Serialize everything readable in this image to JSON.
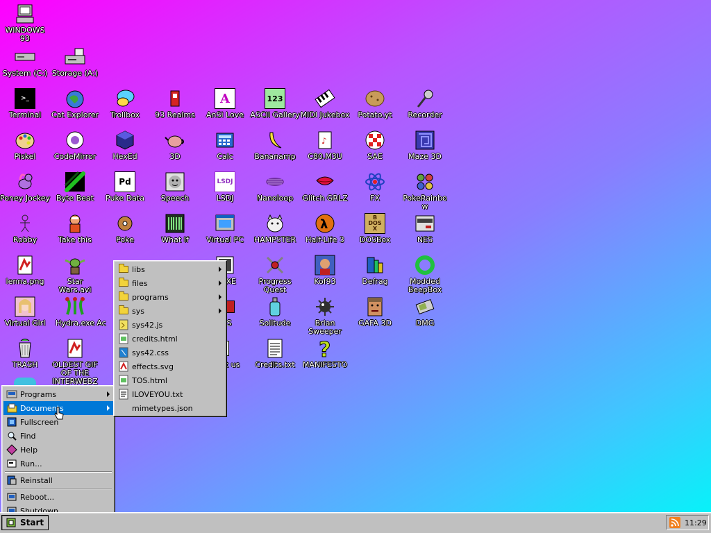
{
  "desktop": {
    "icons": [
      {
        "label": "WINDOWS 93",
        "icon": "computer-icon"
      },
      {
        "label": "System (C:)",
        "icon": "drive-icon"
      },
      {
        "label": "Storage (A:)",
        "icon": "floppy-drive-icon"
      },
      {
        "label": "Terminal",
        "icon": "terminal-icon"
      },
      {
        "label": "Cat Explorer",
        "icon": "cat-globe-icon"
      },
      {
        "label": "Trollbox",
        "icon": "chat-bubble-icon"
      },
      {
        "label": "93 Realms",
        "icon": "realms-icon"
      },
      {
        "label": "AnSi Love",
        "icon": "ansi-icon"
      },
      {
        "label": "ASCII Gallery",
        "icon": "ascii-icon"
      },
      {
        "label": "MIDI Jukebox",
        "icon": "piano-icon"
      },
      {
        "label": "Potato.yt",
        "icon": "potato-icon"
      },
      {
        "label": "Recorder",
        "icon": "microphone-icon"
      },
      {
        "label": "Piskel",
        "icon": "palette-icon"
      },
      {
        "label": "CodeMirror",
        "icon": "codemirror-icon"
      },
      {
        "label": "HexEd",
        "icon": "cube-icon"
      },
      {
        "label": "3D",
        "icon": "teapot-icon"
      },
      {
        "label": "Calc",
        "icon": "calculator-icon"
      },
      {
        "label": "Bananamp",
        "icon": "banana-icon"
      },
      {
        "label": "C80.M3U",
        "icon": "playlist-icon"
      },
      {
        "label": "SAE",
        "icon": "amiga-ball-icon"
      },
      {
        "label": "Maze 3D",
        "icon": "maze-icon"
      },
      {
        "label": "Poney Jockey",
        "icon": "pony-icon"
      },
      {
        "label": "Byte Beat",
        "icon": "bytebeat-icon"
      },
      {
        "label": "Puke Data",
        "icon": "puredata-icon"
      },
      {
        "label": "Speech",
        "icon": "face-icon"
      },
      {
        "label": "LSDJ",
        "icon": "lsdj-icon"
      },
      {
        "label": "Nanoloop",
        "icon": "wave-icon"
      },
      {
        "label": "Glitch GRLZ",
        "icon": "lips-icon"
      },
      {
        "label": "FX",
        "icon": "atom-icon"
      },
      {
        "label": "PokeRainbow",
        "icon": "pokemon-trainers-icon"
      },
      {
        "label": "Robby",
        "icon": "stick-figure-icon"
      },
      {
        "label": "Take this",
        "icon": "take-this-icon"
      },
      {
        "label": "Poke",
        "icon": "pokeball-icon"
      },
      {
        "label": "What If",
        "icon": "barcode-icon"
      },
      {
        "label": "Virtual PC",
        "icon": "virtual-pc-icon"
      },
      {
        "label": "HAMPSTER",
        "icon": "hamster-icon"
      },
      {
        "label": "Half-Life 3",
        "icon": "half-life-icon"
      },
      {
        "label": "DOSBox",
        "icon": "dosbox-icon"
      },
      {
        "label": "NES",
        "icon": "nes-icon"
      },
      {
        "label": "lenna.png",
        "icon": "image-file-icon"
      },
      {
        "label": "Star Wars.avi",
        "icon": "yoda-icon"
      },
      {
        "label": "2.EXE",
        "icon": "exe-icon"
      },
      {
        "label": "Progress Quest",
        "icon": "swords-icon"
      },
      {
        "label": "Kof93",
        "icon": "fighter-icon"
      },
      {
        "label": "Defrag",
        "icon": "defrag-icon"
      },
      {
        "label": "Modded BeepBox",
        "icon": "ring-icon"
      },
      {
        "label": "Virtual Girl",
        "icon": "virtual-girl-icon"
      },
      {
        "label": "Hydra.exe",
        "icon": "hydra-icon"
      },
      {
        "label": "Ac",
        "icon": "app-icon"
      },
      {
        "label": "S",
        "icon": "app-icon"
      },
      {
        "label": "Solitude",
        "icon": "bottle-icon"
      },
      {
        "label": "Brian Sweeper",
        "icon": "mine-icon"
      },
      {
        "label": "GAFA 3D",
        "icon": "doom-face-icon"
      },
      {
        "label": "DMG",
        "icon": "gameboy-icon"
      },
      {
        "label": "TRASH",
        "icon": "trash-icon"
      },
      {
        "label": "OLDEST GIF OF THE INTERWEBZ",
        "icon": "gif-file-icon"
      },
      {
        "label": "ct us",
        "icon": "contact-icon"
      },
      {
        "label": "Credits.txt",
        "icon": "text-file-icon"
      },
      {
        "label": "MANIFESTO",
        "icon": "question-mark-icon"
      }
    ]
  },
  "start_menu": {
    "items": [
      {
        "label": "Programs",
        "icon": "programs-icon",
        "submenu": true
      },
      {
        "label": "Documents",
        "icon": "documents-icon",
        "submenu": true,
        "active": true
      },
      {
        "label": "Fullscreen",
        "icon": "fullscreen-icon"
      },
      {
        "label": "Find",
        "icon": "find-icon"
      },
      {
        "label": "Help",
        "icon": "help-icon"
      },
      {
        "label": "Run...",
        "icon": "run-icon"
      },
      {
        "label": "Reinstall",
        "icon": "reinstall-icon"
      },
      {
        "label": "Reboot...",
        "icon": "reboot-icon"
      },
      {
        "label": "Shutdown",
        "icon": "shutdown-icon"
      }
    ]
  },
  "documents_menu": {
    "items": [
      {
        "label": "libs",
        "icon": "folder-icon",
        "submenu": true
      },
      {
        "label": "files",
        "icon": "folder-icon",
        "submenu": true
      },
      {
        "label": "programs",
        "icon": "folder-icon",
        "submenu": true
      },
      {
        "label": "sys",
        "icon": "folder-icon",
        "submenu": true
      },
      {
        "label": "sys42.js",
        "icon": "js-file-icon"
      },
      {
        "label": "credits.html",
        "icon": "html-file-icon"
      },
      {
        "label": "sys42.css",
        "icon": "css-file-icon"
      },
      {
        "label": "effects.svg",
        "icon": "svg-file-icon"
      },
      {
        "label": "TOS.html",
        "icon": "html-file-icon"
      },
      {
        "label": "ILOVEYOU.txt",
        "icon": "txt-file-icon"
      },
      {
        "label": "mimetypes.json",
        "icon": "json-file-icon"
      }
    ]
  },
  "taskbar": {
    "start_label": "Start",
    "clock": "11:29"
  }
}
